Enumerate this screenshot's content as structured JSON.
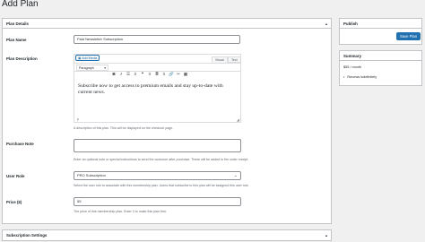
{
  "page": {
    "title": "Add Plan"
  },
  "plan_details": {
    "heading": "Plan Details",
    "name": {
      "label": "Plan Name",
      "value": "Paid Newsletter Subscription"
    },
    "description": {
      "label": "Plan Description",
      "add_media": "Add Media",
      "tab_visual": "Visual",
      "tab_text": "Text",
      "format": "Paragraph",
      "content": "Subscribe now to get access to premium emails and stay up-to-date with current news.",
      "path": "p",
      "help": "A description of this plan. This will be displayed on the checkout page."
    },
    "purchase_note": {
      "label": "Purchase Note",
      "value": "",
      "help": "Enter an optional note or special instructions to send the customer after purchase. These will be added to the order receipt."
    },
    "user_role": {
      "label": "User Role",
      "value": "PRO Subscription",
      "help": "Select the user role to associate with this membership plan. Users that subscribe to this plan will be assigned this user role."
    },
    "price": {
      "label": "Price ($)",
      "value": "55",
      "help": "The price of this membership plan. Enter 0 to make this plan free."
    }
  },
  "subscription_settings": {
    "heading": "Subscription Settings"
  },
  "publish": {
    "heading": "Publish",
    "button": "Save Plan"
  },
  "summary": {
    "heading": "Summary",
    "price_line": "$55 / month",
    "renewal": "Renews indefinitely"
  },
  "colors": {
    "accent": "#2271b1",
    "border": "#c3c4c7",
    "background": "#f0f0f1"
  }
}
